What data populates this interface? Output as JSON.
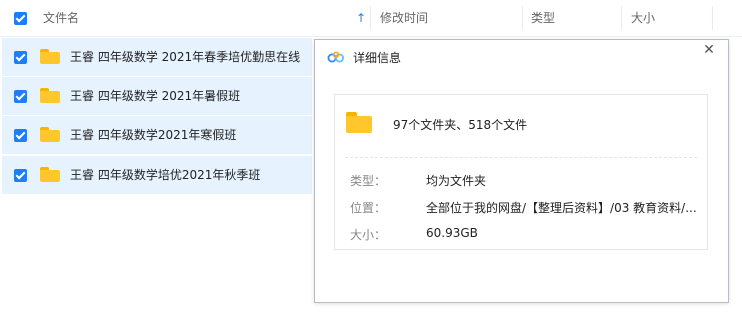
{
  "header": {
    "columns": {
      "name": "文件名",
      "modified": "修改时间",
      "type": "类型",
      "size": "大小"
    },
    "sort_icon": "arrow-up-icon"
  },
  "files": [
    {
      "name": "王睿 四年级数学 2021年春季培优勤思在线"
    },
    {
      "name": "王睿 四年级数学 2021年暑假班"
    },
    {
      "name": "王睿 四年级数学2021年寒假班"
    },
    {
      "name": "王睿 四年级数学培优2021年秋季班"
    }
  ],
  "dialog": {
    "title": "详细信息",
    "close_icon": "close-icon",
    "summary": "97个文件夹、518个文件",
    "type_label": "类型：",
    "type_value": "均为文件夹",
    "location_label": "位置：",
    "location_value": "全部位于我的网盘/【整理后资料】/03 教育资料/...",
    "size_label": "大小：",
    "size_value": "60.93GB"
  },
  "colors": {
    "accent": "#1f7ef7",
    "selected_row": "#e6f3ff",
    "folder": "#ffc72c"
  }
}
